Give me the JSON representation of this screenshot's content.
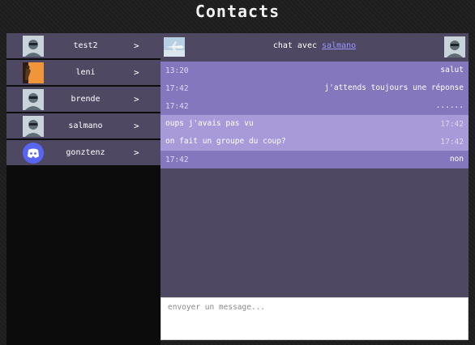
{
  "page_title": "Contacts",
  "contacts": [
    {
      "name": "test2",
      "avatar": "default-avatar-icon"
    },
    {
      "name": "leni",
      "avatar": "orange-figure-avatar"
    },
    {
      "name": "brende",
      "avatar": "default-avatar-icon"
    },
    {
      "name": "salmano",
      "avatar": "default-avatar-icon"
    },
    {
      "name": "gonztenz",
      "avatar": "discord-logo-icon"
    }
  ],
  "chevron": ">",
  "chat": {
    "header_prefix": "chat avec",
    "header_user": "salmano",
    "messages": [
      {
        "time": "13:20",
        "text": "salut",
        "dir": "in"
      },
      {
        "time": "17:42",
        "text": "j'attends toujours une réponse",
        "dir": "in"
      },
      {
        "time": "17:42",
        "text": "......",
        "dir": "in"
      },
      {
        "time": "17:42",
        "text": "oups j'avais pas vu",
        "dir": "out"
      },
      {
        "time": "17:42",
        "text": "on fait un groupe du coup?",
        "dir": "out"
      },
      {
        "time": "17:42",
        "text": "non",
        "dir": "in"
      }
    ]
  },
  "composer": {
    "placeholder": "envoyer un message..."
  }
}
